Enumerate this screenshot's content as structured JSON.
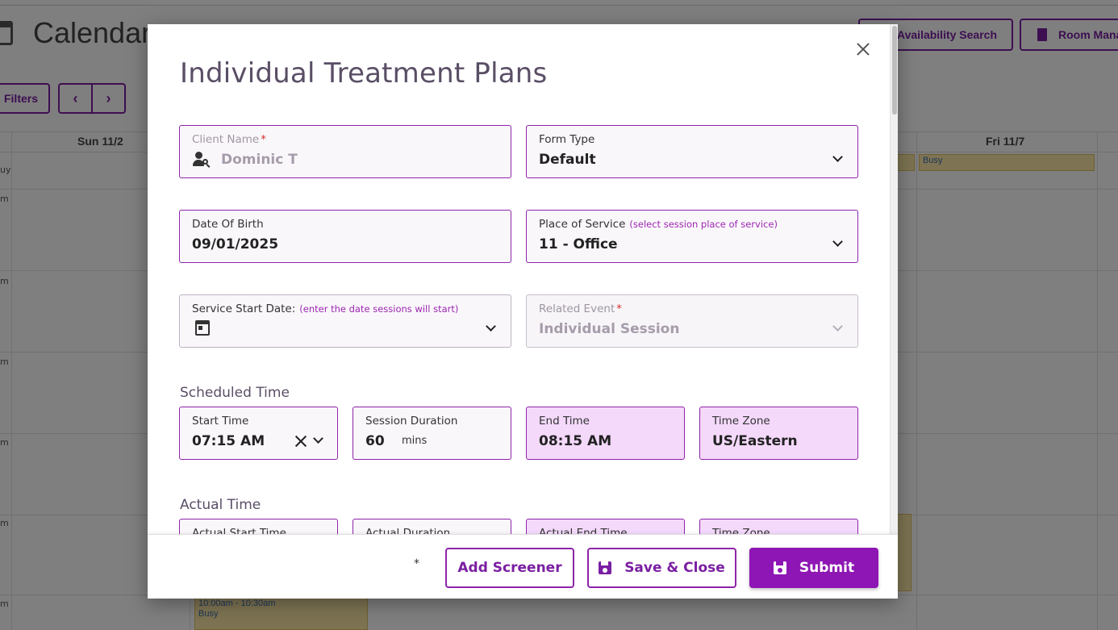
{
  "background": {
    "title": "Calendar",
    "filters_label": "Filters",
    "prev_icon": "‹",
    "next_icon": "›",
    "availability_label": "Availability Search",
    "room_label": "Room Mana",
    "days": [
      "Sun 11/2",
      "Fri 11/7"
    ],
    "time_letter": "m",
    "busy_row_label": "uy",
    "event_busy": "Busy",
    "event_time": "10:00am - 10:30am"
  },
  "modal": {
    "title": "Individual Treatment Plans",
    "close_icon": "close-icon",
    "fields": {
      "client_name": {
        "label": "Client Name",
        "required": "*",
        "value": "Dominic T",
        "icon": "user-search-icon"
      },
      "form_type": {
        "label": "Form Type",
        "value": "Default"
      },
      "dob": {
        "label": "Date Of Birth",
        "value": "09/01/2025"
      },
      "place_of_service": {
        "label": "Place of Service",
        "hint": "(select session place of service)",
        "value": "11 - Office"
      },
      "service_start": {
        "label": "Service Start Date:",
        "hint": "(enter the date sessions will start)",
        "value": "",
        "icon": "calendar-icon"
      },
      "related_event": {
        "label": "Related Event",
        "required": "*",
        "value": "Individual Session"
      }
    },
    "scheduled": {
      "heading": "Scheduled Time",
      "start_time": {
        "label": "Start Time",
        "value": "07:15 AM"
      },
      "duration": {
        "label": "Session Duration",
        "value": "60",
        "unit": "mins"
      },
      "end_time": {
        "label": "End Time",
        "value": "08:15 AM"
      },
      "time_zone": {
        "label": "Time Zone",
        "value": "US/Eastern"
      }
    },
    "actual": {
      "heading": "Actual Time",
      "start_time": {
        "label": "Actual Start Time"
      },
      "duration": {
        "label": "Actual Duration"
      },
      "end_time": {
        "label": "Actual End Time"
      },
      "time_zone": {
        "label": "Time Zone"
      }
    },
    "footer": {
      "asterisk": "*",
      "add_screener": "Add Screener",
      "save_close": "Save & Close",
      "submit": "Submit"
    }
  },
  "colors": {
    "accent": "#8e16b4",
    "accent_border": "#8e24aa",
    "readonly_fill": "#f4d9fb",
    "busy_event": "#fde9a6"
  }
}
